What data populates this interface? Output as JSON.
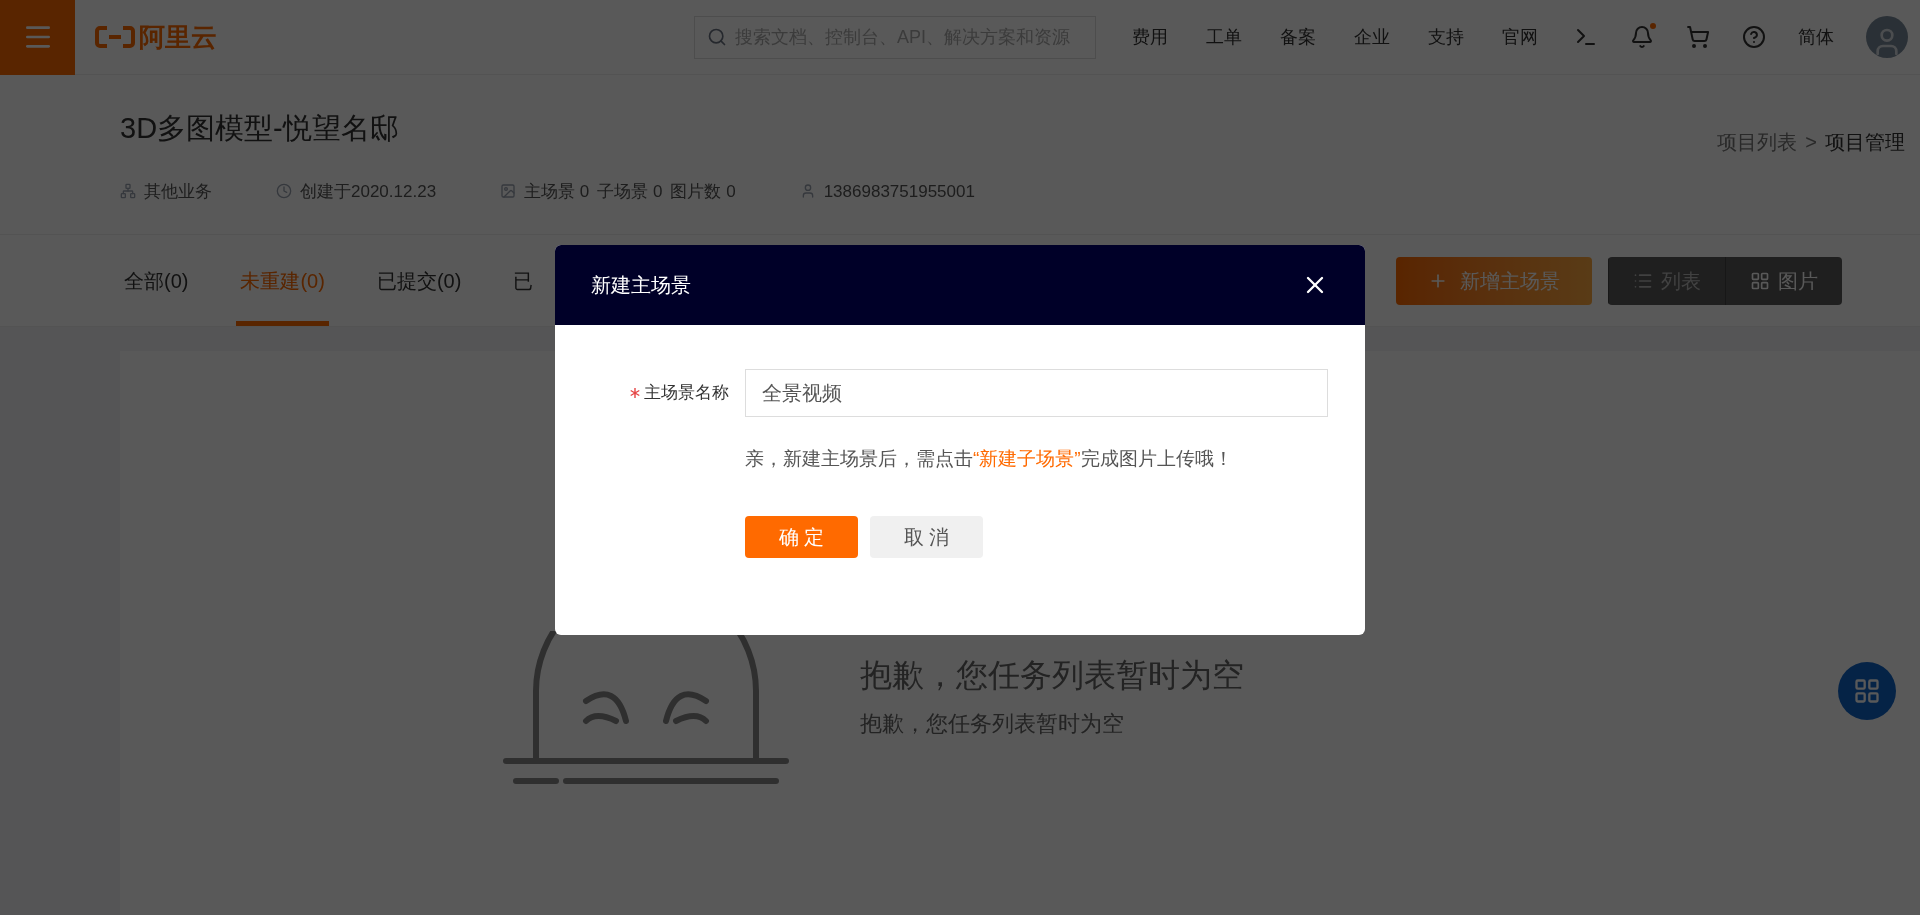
{
  "header": {
    "logo": "阿里云",
    "search": {
      "placeholder": "搜索文档、控制台、API、解决方案和资源"
    },
    "nav": [
      "费用",
      "工单",
      "备案",
      "企业",
      "支持",
      "官网"
    ],
    "notification": {
      "unread": true
    },
    "language": "简体"
  },
  "project": {
    "title": "3D多图模型-悦望名邸",
    "meta": [
      {
        "kind": "category",
        "texts": [
          "其他业务"
        ]
      },
      {
        "kind": "date",
        "texts": [
          "创建于2020.12.23"
        ]
      },
      {
        "kind": "image",
        "texts": [
          "主场景 0",
          "子场景 0",
          "图片数 0"
        ]
      },
      {
        "kind": "user",
        "texts": [
          "1386983751955001"
        ]
      }
    ],
    "breadcrumb": {
      "items": [
        "项目列表",
        "项目管理"
      ],
      "separator": ">"
    }
  },
  "tabs": [
    {
      "label": "全部(0)",
      "selected": false
    },
    {
      "label": "未重建(0)",
      "selected": true
    },
    {
      "label": "已提交(0)",
      "selected": false
    },
    {
      "label": "已",
      "selected": false
    }
  ],
  "add_button": "新增主场景",
  "view_toggle": [
    {
      "label": "列表",
      "selected": false
    },
    {
      "label": "图片",
      "selected": true
    }
  ],
  "empty_state": {
    "title": "抱歉，您任务列表暂时为空",
    "subtitle": "抱歉，您任务列表暂时为空"
  },
  "dialog": {
    "title": "新建主场景",
    "field": {
      "label": "主场景名称",
      "required": true,
      "value": "全景视频"
    },
    "hint": [
      {
        "text": "亲，新建主场景后，需点击",
        "highlight": false
      },
      {
        "text": "“新建子场景”",
        "highlight": true
      },
      {
        "text": "完成图片上传哦！",
        "highlight": false
      }
    ],
    "buttons": [
      {
        "kind": "primary",
        "label": "确 定"
      },
      {
        "kind": "secondary",
        "label": "取 消"
      }
    ]
  }
}
